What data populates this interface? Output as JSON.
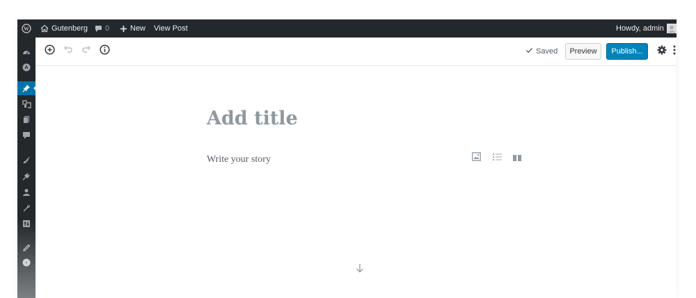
{
  "adminbar": {
    "site_name": "Gutenberg",
    "comments_count": "0",
    "new_label": "New",
    "view_post_label": "View Post",
    "howdy_label": "Howdy, admin"
  },
  "toolbar": {
    "saved_label": "Saved",
    "preview_label": "Preview",
    "publish_label": "Publish..."
  },
  "editor": {
    "title_placeholder": "Add title",
    "body_placeholder": "Write your story"
  },
  "colors": {
    "adminbar_bg": "#23282d",
    "accent": "#0073aa",
    "publish_bg": "#0085ba"
  }
}
